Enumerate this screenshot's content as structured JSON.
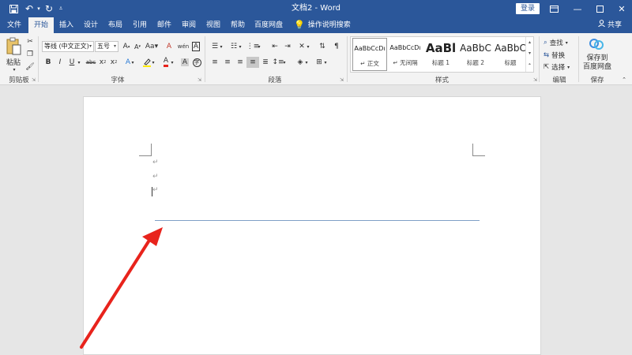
{
  "title": "文档2 - Word",
  "login_label": "登录",
  "share_label": "共享",
  "tell_me": "操作说明搜索",
  "quick_access": {
    "save_icon": "save-icon",
    "undo_icon": "undo-icon",
    "redo_icon": "redo-icon",
    "customize_icon": "customize-icon"
  },
  "tabs": [
    "文件",
    "开始",
    "插入",
    "设计",
    "布局",
    "引用",
    "邮件",
    "审阅",
    "视图",
    "帮助",
    "百度网盘"
  ],
  "active_tab": "开始",
  "window_controls": [
    "ribbon-display-icon",
    "minimize-icon",
    "maximize-icon",
    "close-icon"
  ],
  "clipboard": {
    "paste_label": "粘贴",
    "group_label": "剪贴板"
  },
  "font": {
    "font_name": "等线 (中文正文)",
    "font_size": "五号",
    "group_label": "字体",
    "buttons": [
      "B",
      "I",
      "U",
      "abc",
      "x₂",
      "x²",
      "A",
      "A",
      "A",
      "A",
      "Aa",
      "wén",
      "A"
    ]
  },
  "paragraph": {
    "group_label": "段落"
  },
  "styles": {
    "group_label": "样式",
    "items": [
      {
        "sample": "AaBbCcDı",
        "name": "↵ 正文"
      },
      {
        "sample": "AaBbCcDı",
        "name": "↵ 无间隔"
      },
      {
        "sample": "AaBl",
        "name": "标题 1"
      },
      {
        "sample": "AaBbC",
        "name": "标题 2"
      },
      {
        "sample": "AaBbC",
        "name": "标题"
      }
    ]
  },
  "editing": {
    "group_label": "编辑",
    "find": "查找",
    "replace": "替换",
    "select": "选择"
  },
  "save_group": {
    "button_line1": "保存到",
    "button_line2": "百度网盘",
    "group_label": "保存"
  },
  "document": {
    "paragraph_mark": "↵"
  },
  "colors": {
    "title_bar": "#2b579a",
    "ribbon_bg": "#f3f3f3",
    "canvas_bg": "#e6e6e6",
    "horizontal_line": "#7f9fc6",
    "annotation_arrow": "#e8231c"
  }
}
